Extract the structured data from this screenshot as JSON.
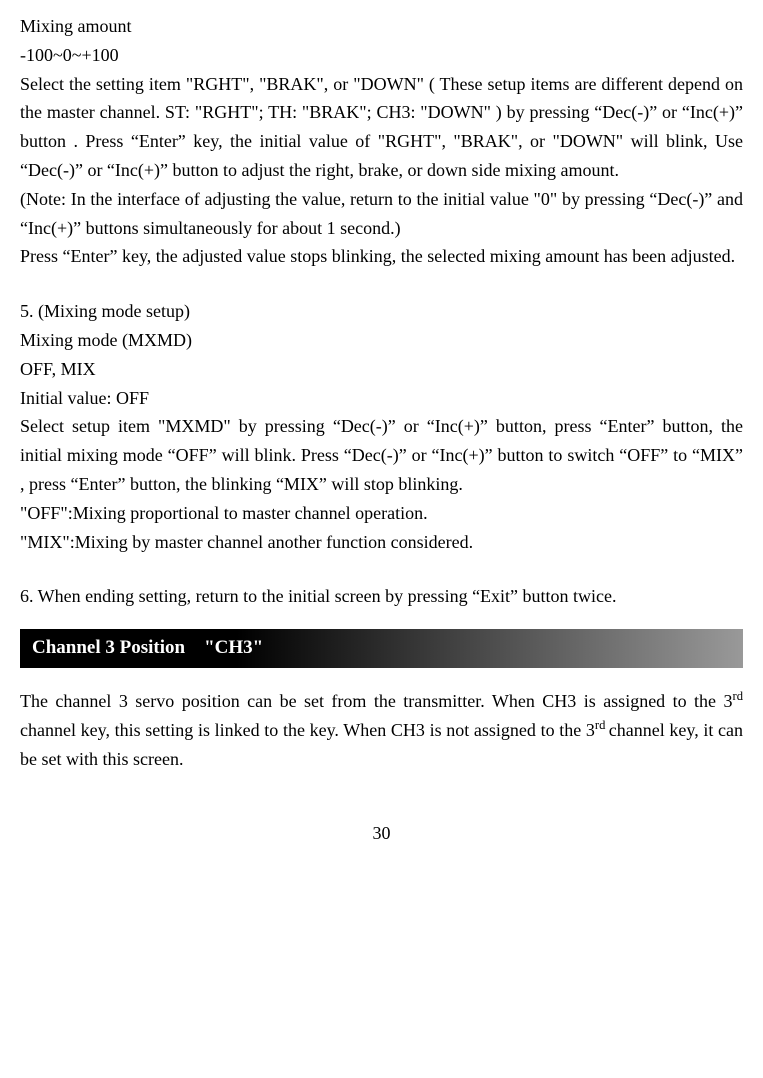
{
  "mixing_amount": {
    "label": "Mixing amount",
    "range": "-100~0~+100",
    "para1": "Select the setting item \"RGHT\", \"BRAK\", or \"DOWN\" ( These setup items are different depend on the master channel. ST: \"RGHT\"; TH: \"BRAK\"; CH3: \"DOWN\" ) by pressing “Dec(-)” or “Inc(+)” button . Press “Enter” key, the initial value of \"RGHT\", \"BRAK\", or \"DOWN\" will blink, Use “Dec(-)” or “Inc(+)” button to adjust the right, brake, or down side mixing amount.",
    "note": "(Note: In the interface of adjusting the value, return to the initial value \"0\" by pressing “Dec(-)” and “Inc(+)” buttons simultaneously for about 1 second.)",
    "para2": "Press “Enter” key, the adjusted value stops blinking, the selected mixing amount has been adjusted."
  },
  "section5": {
    "title": "5. (Mixing mode setup)",
    "mode_label": "Mixing mode (MXMD)",
    "options": "OFF, MIX",
    "initial": "Initial value: OFF",
    "para1": "Select setup item \"MXMD\" by pressing “Dec(-)” or “Inc(+)” button, press “Enter” button, the initial mixing mode “OFF” will blink. Press “Dec(-)” or “Inc(+)” button to switch “OFF” to “MIX” , press  “Enter” button, the blinking “MIX” will stop blinking.",
    "off_desc": "\"OFF\":Mixing proportional to master channel operation.",
    "mix_desc": "\"MIX\":Mixing by master channel another function considered."
  },
  "section6": {
    "text": "6. When ending setting, return to the initial screen by pressing “Exit” button twice."
  },
  "header": {
    "title": "Channel 3 Position    \"CH3\""
  },
  "ch3": {
    "para_pre": "The channel 3 servo position can be set from the transmitter. When CH3 is assigned to the 3",
    "rd1": "rd ",
    "para_mid": "channel key, this setting is linked to the key. When CH3 is not assigned to the 3",
    "rd2": "rd ",
    "para_end": "channel key, it can be set with this screen."
  },
  "page_number": "30"
}
